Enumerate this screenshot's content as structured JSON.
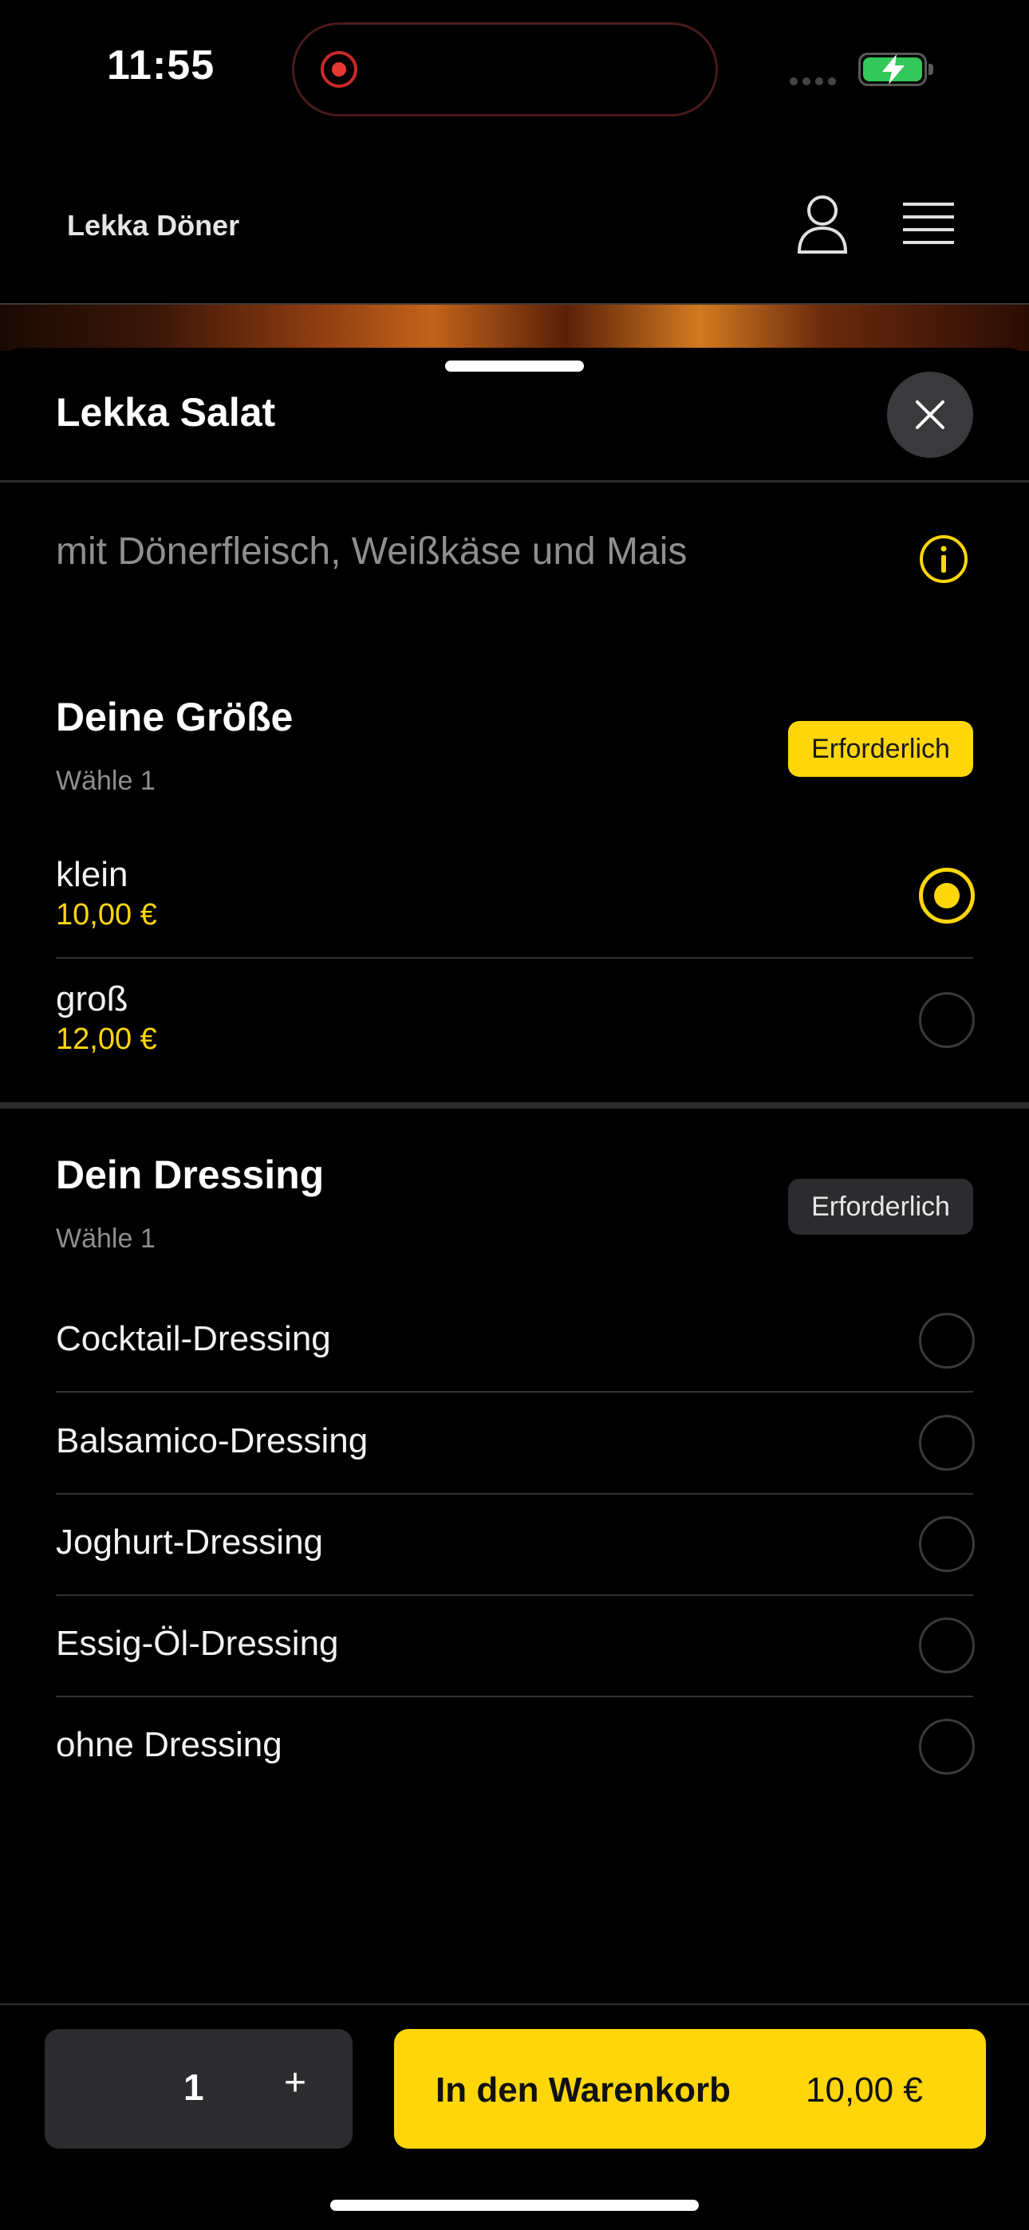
{
  "status_bar": {
    "time": "11:55"
  },
  "header": {
    "brand": "Lekka Döner"
  },
  "sheet": {
    "title": "Lekka Salat",
    "description": "mit Dönerfleisch, Weißkäse und Mais"
  },
  "size_section": {
    "title": "Deine Größe",
    "subtitle": "Wähle 1",
    "badge": "Erforderlich",
    "options": [
      {
        "label": "klein",
        "price": "10,00 €",
        "selected": true
      },
      {
        "label": "groß",
        "price": "12,00 €",
        "selected": false
      }
    ]
  },
  "dressing_section": {
    "title": "Dein Dressing",
    "subtitle": "Wähle 1",
    "badge": "Erforderlich",
    "options": [
      {
        "label": "Cocktail-Dressing"
      },
      {
        "label": "Balsamico-Dressing"
      },
      {
        "label": "Joghurt-Dressing"
      },
      {
        "label": "Essig-Öl-Dressing"
      },
      {
        "label": "ohne Dressing"
      }
    ]
  },
  "footer": {
    "quantity": "1",
    "plus": "+",
    "cart_label": "In den Warenkorb",
    "cart_price": "10,00 €"
  },
  "colors": {
    "accent": "#ffd60a",
    "background": "#000000"
  }
}
